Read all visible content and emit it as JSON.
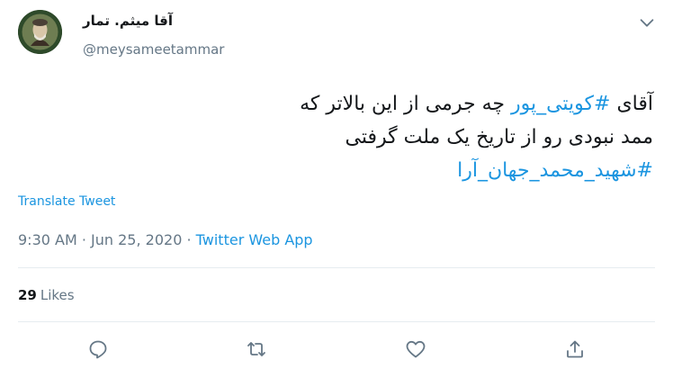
{
  "author": {
    "display_name": "آقا میثم. تمار",
    "handle": "@meysameetammar"
  },
  "tweet": {
    "line1_prefix": "آقای ",
    "line1_hashtag": "#کویتی_پور",
    "line1_suffix": " چه جرمی از این بالاتر که",
    "line2": "ممد نبودی رو از تاریخ یک ملت گرفتی",
    "line3_hashtag": "#شهید_محمد_جهان_آرا"
  },
  "translate_label": "Translate Tweet",
  "meta": {
    "time": "9:30 AM",
    "separator1": " · ",
    "date": "Jun 25, 2020",
    "separator2": " · ",
    "source": "Twitter Web App"
  },
  "stats": {
    "likes_count": "29",
    "likes_label": "Likes"
  },
  "icons": {
    "chevron": "chevron-down-icon",
    "reply": "reply-icon",
    "retweet": "retweet-icon",
    "like": "heart-icon",
    "share": "share-icon"
  },
  "colors": {
    "link": "#1b95e0",
    "secondary_text": "#657786",
    "primary_text": "#14171a",
    "divider": "#e6ecf0"
  }
}
